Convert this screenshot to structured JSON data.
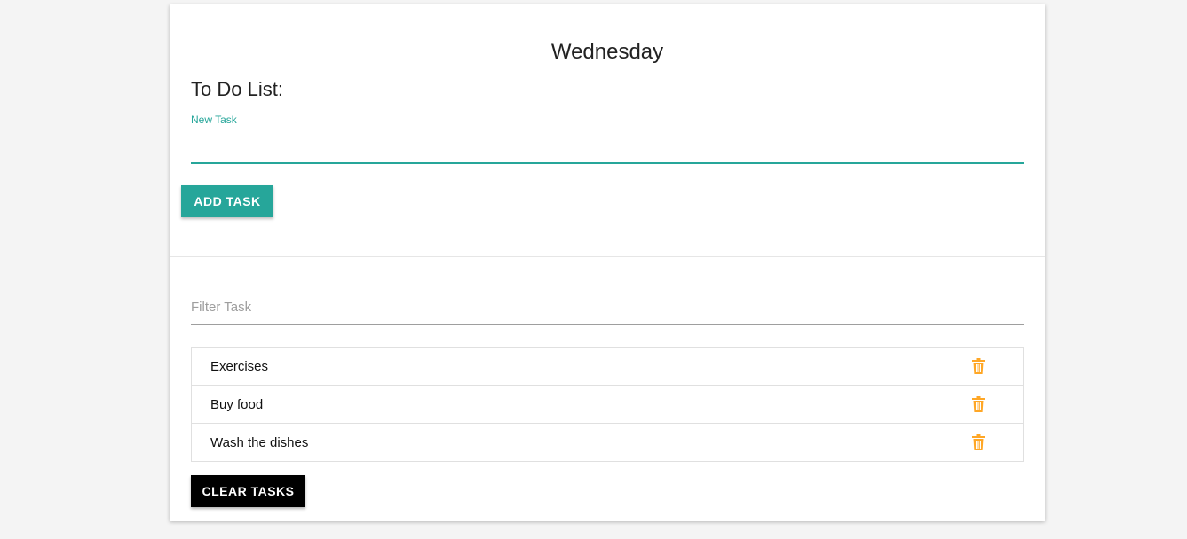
{
  "header": {
    "day": "Wednesday",
    "list_title": "To Do List:"
  },
  "new_task": {
    "label": "New Task",
    "value": "",
    "add_button_label": "ADD TASK"
  },
  "filter": {
    "placeholder": "Filter Task",
    "value": ""
  },
  "tasks": [
    {
      "text": "Exercises",
      "icon": "trash-icon"
    },
    {
      "text": "Buy food",
      "icon": "trash-icon"
    },
    {
      "text": "Wash the dishes",
      "icon": "trash-icon"
    }
  ],
  "clear_button_label": "CLEAR TASKS",
  "colors": {
    "accent": "#26a69a",
    "trash": "#ffa726",
    "clear_button": "#000000"
  }
}
